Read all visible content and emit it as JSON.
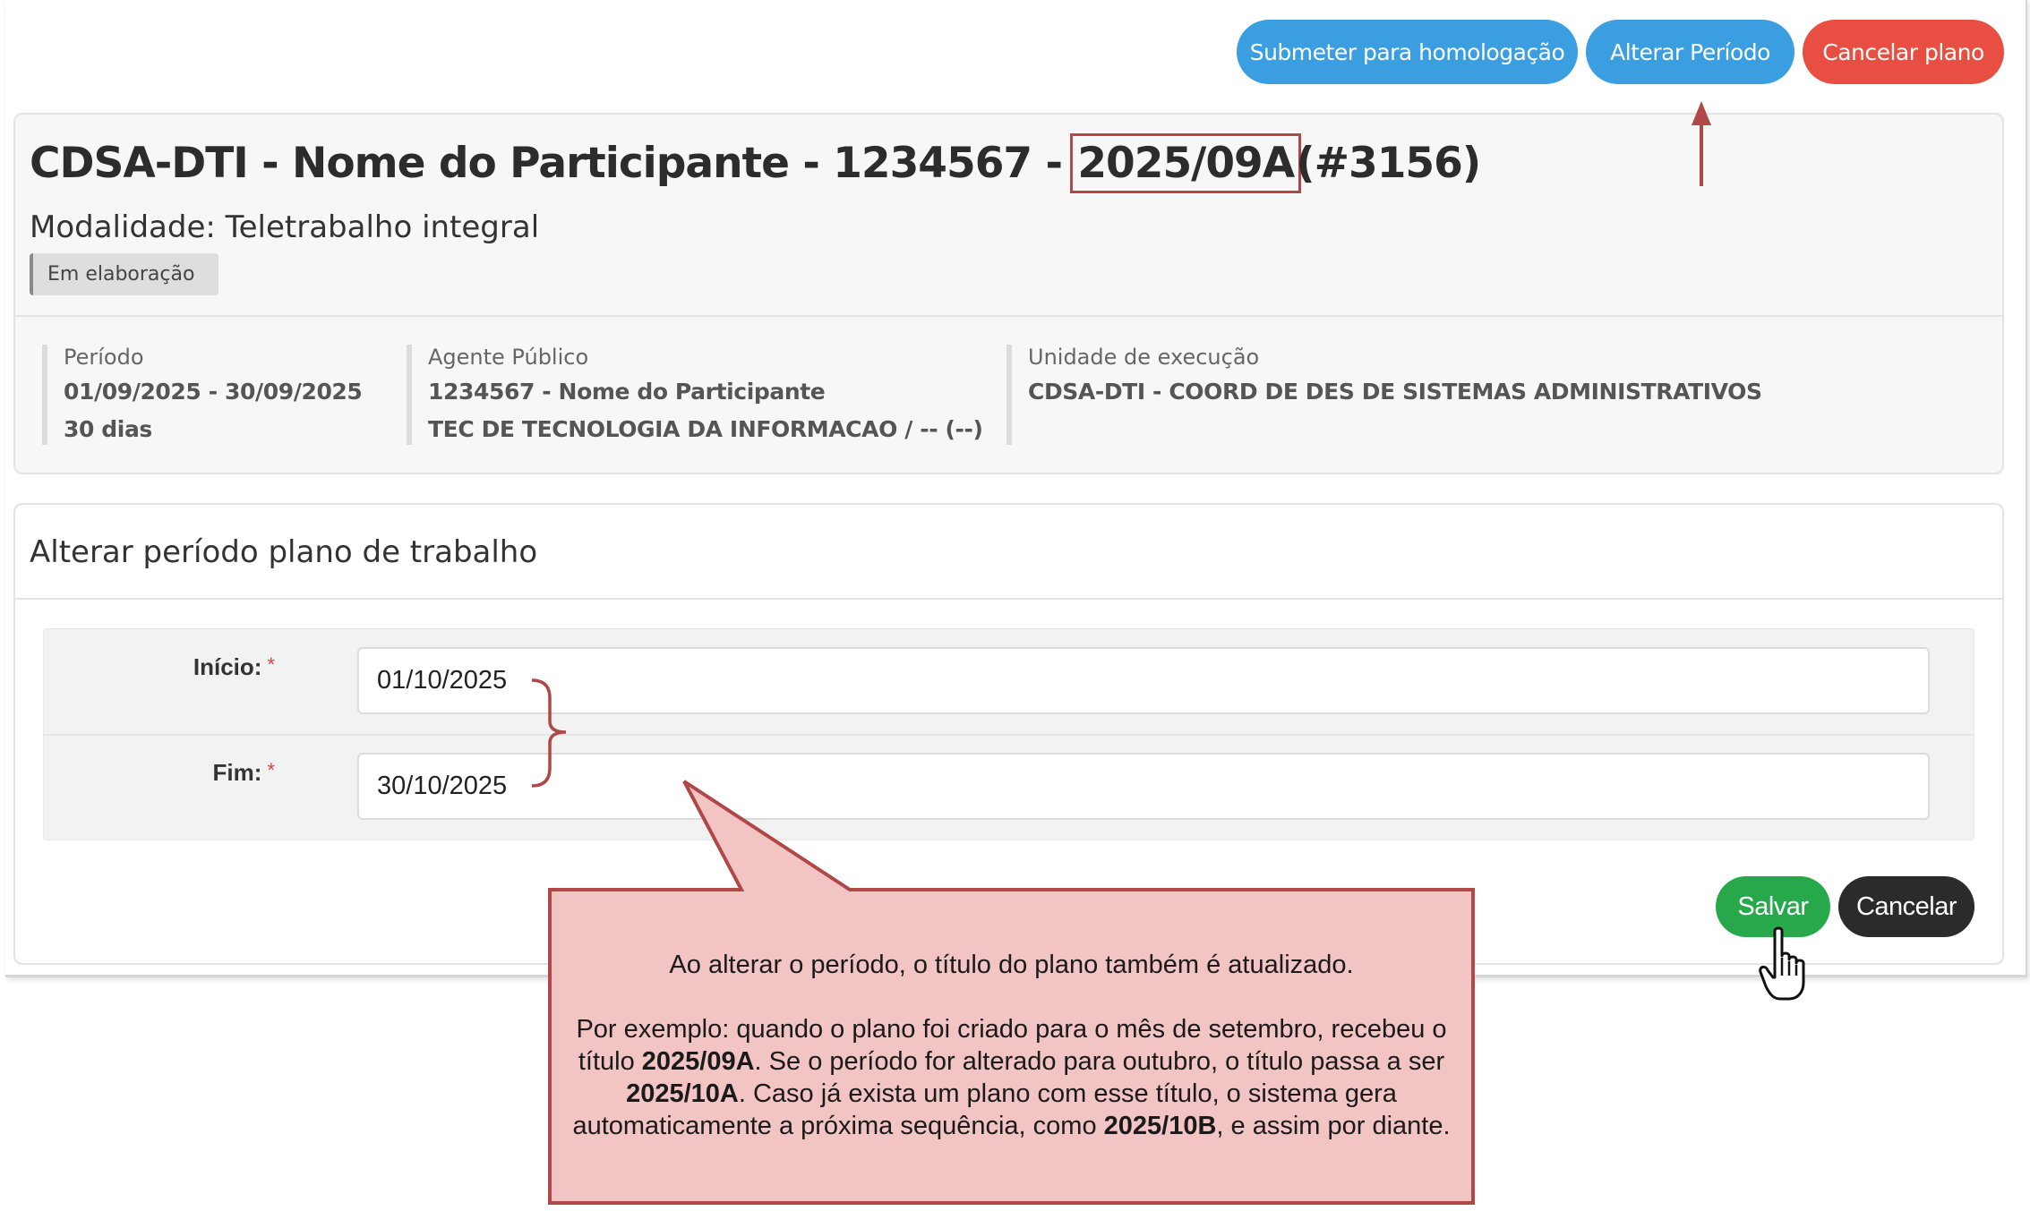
{
  "actions": {
    "submit_label": "Submeter para homologação",
    "change_period_label": "Alterar Período",
    "cancel_plan_label": "Cancelar plano"
  },
  "plan": {
    "title_prefix": "CDSA-DTI - Nome do Participante - 1234567 -",
    "title_code": "2025/09A",
    "title_id": "(#3156)",
    "modality": "Modalidade: Teletrabalho integral",
    "status": "Em elaboração"
  },
  "info": {
    "period": {
      "label": "Período",
      "range": "01/09/2025 - 30/09/2025",
      "days": "30 dias"
    },
    "agent": {
      "label": "Agente Público",
      "name": "1234567 - Nome do Participante",
      "role": "TEC DE TECNOLOGIA DA INFORMACAO / -- (--)"
    },
    "unit": {
      "label": "Unidade de execução",
      "name": "CDSA-DTI - COORD DE DES DE SISTEMAS ADMINISTRATIVOS"
    }
  },
  "form": {
    "title": "Alterar período plano de trabalho",
    "start_label": "Início:",
    "start_value": "01/10/2025",
    "end_label": "Fim:",
    "end_value": "30/10/2025",
    "required_mark": "*",
    "save_label": "Salvar",
    "cancel_label": "Cancelar"
  },
  "callout": {
    "line1": "Ao alterar o período, o título do plano também é atualizado.",
    "p2_a": "Por exemplo: quando o plano foi criado para o mês de setembro, recebeu o título ",
    "p2_b": "2025/09A",
    "p2_c": ". Se o período for alterado para outubro, o título passa a ser ",
    "p2_d": "2025/10A",
    "p2_e": ". Caso já exista um plano com esse título, o sistema gera automaticamente a próxima sequência, como ",
    "p2_f": "2025/10B",
    "p2_g": ", e assim por diante.",
    "fill_color": "#f3c4c4",
    "border_color": "#b04848"
  }
}
